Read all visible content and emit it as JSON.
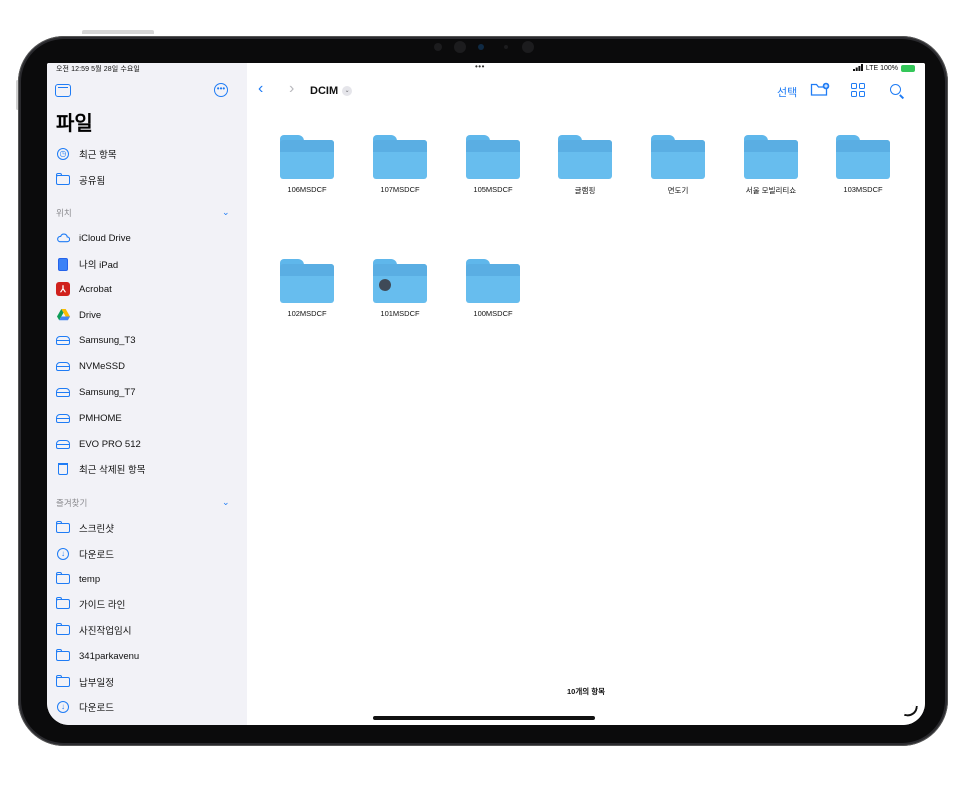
{
  "status": {
    "time_date": "오전 12:59  5월 28일 수요일",
    "dots": "•••",
    "right": "LTE  100%"
  },
  "sidebar": {
    "title": "파일",
    "top_items": [
      {
        "label": "최근 항목",
        "icon": "clock-icon"
      },
      {
        "label": "공유됨",
        "icon": "shared-folder-icon"
      }
    ],
    "location_header": "위치",
    "locations": [
      {
        "label": "iCloud Drive",
        "icon": "cloud-icon"
      },
      {
        "label": "나의 iPad",
        "icon": "ipad-icon"
      },
      {
        "label": "Acrobat",
        "icon": "acrobat-icon"
      },
      {
        "label": "Drive",
        "icon": "google-drive-icon"
      },
      {
        "label": "Samsung_T3",
        "icon": "external-drive-icon"
      },
      {
        "label": "NVMeSSD",
        "icon": "external-drive-icon"
      },
      {
        "label": "Samsung_T7",
        "icon": "external-drive-icon"
      },
      {
        "label": "PMHOME",
        "icon": "external-drive-icon"
      },
      {
        "label": "EVO PRO 512",
        "icon": "external-drive-icon"
      },
      {
        "label": "최근 삭제된 항목",
        "icon": "trash-icon"
      }
    ],
    "favorites_header": "즐겨찾기",
    "favorites": [
      {
        "label": "스크린샷",
        "icon": "folder-icon"
      },
      {
        "label": "다운로드",
        "icon": "download-icon"
      },
      {
        "label": "temp",
        "icon": "folder-icon"
      },
      {
        "label": "가이드 라인",
        "icon": "folder-icon"
      },
      {
        "label": "사진작업임시",
        "icon": "folder-icon"
      },
      {
        "label": "341parkavenu",
        "icon": "folder-icon"
      },
      {
        "label": "납부일정",
        "icon": "folder-icon"
      },
      {
        "label": "다운로드",
        "icon": "download-icon"
      }
    ]
  },
  "nav": {
    "title": "DCIM",
    "select_label": "선택"
  },
  "folders": [
    {
      "name": "106MSDCF"
    },
    {
      "name": "107MSDCF"
    },
    {
      "name": "105MSDCF"
    },
    {
      "name": "글램핑"
    },
    {
      "name": "면도기"
    },
    {
      "name": "서울 모빌리티쇼"
    },
    {
      "name": "103MSDCF"
    },
    {
      "name": "102MSDCF"
    },
    {
      "name": "101MSDCF"
    },
    {
      "name": "100MSDCF"
    }
  ],
  "items_count": "10개의 항목"
}
